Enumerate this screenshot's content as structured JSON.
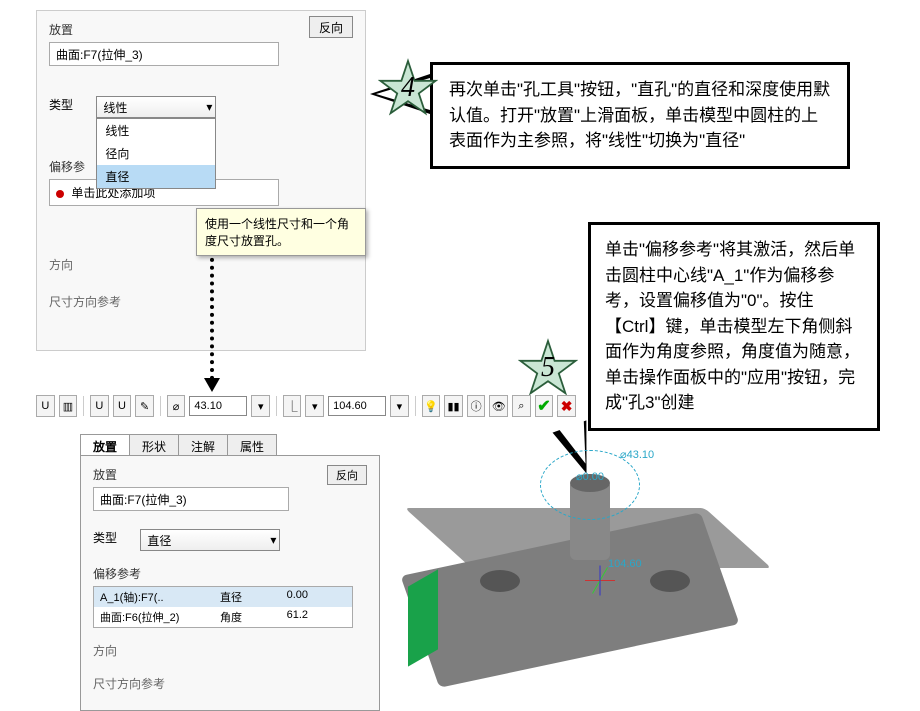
{
  "panel_top": {
    "placement_label": "放置",
    "placement_value": "曲面:F7(拉伸_3)",
    "flip_label": "反向",
    "type_label": "类型",
    "type_value": "线性",
    "type_options": [
      "线性",
      "径向",
      "直径"
    ],
    "offset_label": "偏移参",
    "offset_hint": "单击此处添加项",
    "tooltip": "使用一个线性尺寸和一个角度尺寸放置孔。",
    "direction_label": "方向",
    "dim_ref_label": "尺寸方向参考"
  },
  "callout4": {
    "text": "再次单击\"孔工具\"按钮，\"直孔\"的直径和深度使用默认值。打开\"放置\"上滑面板，单击模型中圆柱的上表面作为主参照，将\"线性\"切换为\"直径\""
  },
  "callout5": {
    "text": "单击\"偏移参考\"将其激活，然后单击圆柱中心线\"A_1\"作为偏移参考，设置偏移值为\"0\"。按住【Ctrl】键，单击模型左下角侧斜面作为角度参照，角度值为随意，单击操作面板中的\"应用\"按钮，完成\"孔3\"创建"
  },
  "star4": "4",
  "star5": "5",
  "toolbar": {
    "diameter": "43.10",
    "depth": "104.60"
  },
  "tabs": [
    "放置",
    "形状",
    "注解",
    "属性"
  ],
  "panel_bottom": {
    "placement_label": "放置",
    "placement_value": "曲面:F7(拉伸_3)",
    "flip_label": "反向",
    "type_label": "类型",
    "type_value": "直径",
    "offset_label": "偏移参考",
    "refs": [
      {
        "name": "A_1(轴):F7(..",
        "mode": "直径",
        "value": "0.00"
      },
      {
        "name": "曲面:F6(拉伸_2)",
        "mode": "角度",
        "value": "61.2"
      }
    ],
    "direction_label": "方向",
    "dim_ref_label": "尺寸方向参考"
  },
  "viewport": {
    "dia_label": "⌀43.10",
    "zero_label": "⌀0.00",
    "depth_label": "104.60"
  }
}
